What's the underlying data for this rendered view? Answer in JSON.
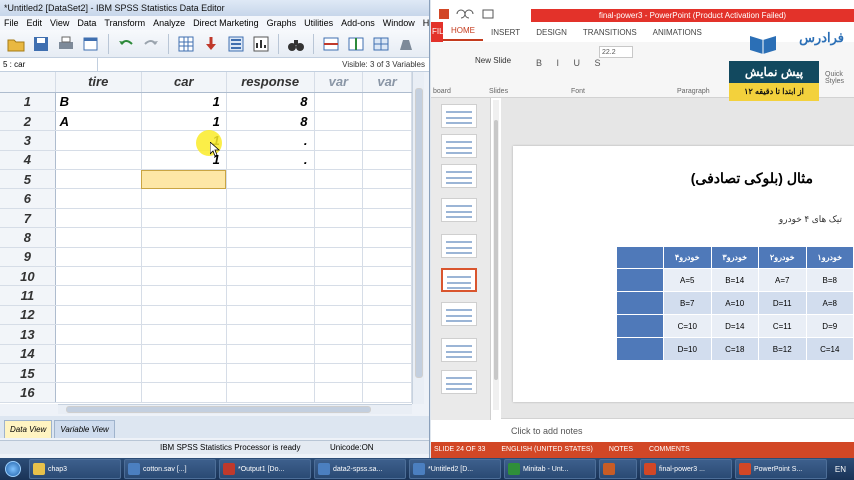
{
  "spss": {
    "title": "*Untitled2 [DataSet2] - IBM SPSS Statistics Data Editor",
    "menu": [
      "File",
      "Edit",
      "View",
      "Data",
      "Transform",
      "Analyze",
      "Direct Marketing",
      "Graphs",
      "Utilities",
      "Add-ons",
      "Window",
      "Help"
    ],
    "cell_ref": "5 : car",
    "cell_value": "",
    "visible_vars": "Visible: 3 of 3 Variables",
    "columns": [
      "tire",
      "car",
      "response",
      "var",
      "var"
    ],
    "rows": [
      {
        "n": "1",
        "tire": "B",
        "car": "1",
        "response": "8"
      },
      {
        "n": "2",
        "tire": "A",
        "car": "1",
        "response": "8"
      },
      {
        "n": "3",
        "tire": "",
        "car": "1",
        "response": "."
      },
      {
        "n": "4",
        "tire": "",
        "car": "1",
        "response": "."
      },
      {
        "n": "5",
        "tire": "",
        "car": "",
        "response": ""
      },
      {
        "n": "6",
        "tire": "",
        "car": "",
        "response": ""
      },
      {
        "n": "7",
        "tire": "",
        "car": "",
        "response": ""
      },
      {
        "n": "8",
        "tire": "",
        "car": "",
        "response": ""
      },
      {
        "n": "9",
        "tire": "",
        "car": "",
        "response": ""
      },
      {
        "n": "10",
        "tire": "",
        "car": "",
        "response": ""
      },
      {
        "n": "11",
        "tire": "",
        "car": "",
        "response": ""
      },
      {
        "n": "12",
        "tire": "",
        "car": "",
        "response": ""
      },
      {
        "n": "13",
        "tire": "",
        "car": "",
        "response": ""
      },
      {
        "n": "14",
        "tire": "",
        "car": "",
        "response": ""
      },
      {
        "n": "15",
        "tire": "",
        "car": "",
        "response": ""
      },
      {
        "n": "16",
        "tire": "",
        "car": "",
        "response": ""
      }
    ],
    "selected_row": 5,
    "tabs": {
      "data": "Data View",
      "variable": "Variable View"
    },
    "status": {
      "processor": "IBM SPSS Statistics Processor is ready",
      "unicode": "Unicode:ON"
    }
  },
  "ppt": {
    "title": "final-power3 - PowerPoint (Product Activation Failed)",
    "file_tab": "FILE",
    "tabs": [
      "HOME",
      "INSERT",
      "DESIGN",
      "TRANSITIONS",
      "ANIMATIONS"
    ],
    "active_tab": "HOME",
    "ribbon": {
      "new_slide": "New Slide",
      "font_size": "22.2",
      "groups": {
        "clipboard": "board",
        "slides": "Slides",
        "font": "Font",
        "paragraph": "Paragraph",
        "styles": "Styles"
      },
      "quick_styles": "Quick Styles"
    },
    "slide": {
      "title": "مثال (بلوکی تصادفی)",
      "subtitle": "تیک های ۴ خودرو",
      "table": [
        [
          "خودرو۱",
          "خودرو۲",
          "خودرو۳",
          "خودرو۴",
          ""
        ],
        [
          "B=8",
          "A=7",
          "B=14",
          "A=5",
          ""
        ],
        [
          "A=8",
          "D=11",
          "A=10",
          "B=7",
          ""
        ],
        [
          "D=9",
          "C=11",
          "D=14",
          "C=10",
          ""
        ],
        [
          "C=14",
          "B=12",
          "C=18",
          "D=10",
          ""
        ]
      ]
    },
    "notes": "Click to add notes",
    "status": {
      "slide": "SLIDE 24 OF 33",
      "lang": "ENGLISH (UNITED STATES)",
      "notes": "NOTES",
      "comments": "COMMENTS"
    }
  },
  "overlay": {
    "brand": "فرادرس",
    "banner_title": "پیش نمایش",
    "banner_sub": "از ابتدا تا دقیقه ۱۲"
  },
  "taskbar": {
    "items": [
      "chap3",
      "cotton.sav [...]",
      "*Output1 [Do...",
      "data2-spss.sa...",
      "*Untitled2 [D...",
      "Minitab - Unt...",
      "",
      "final-power3 ...",
      "PowerPoint S..."
    ],
    "icon_colors": [
      "#e8c14a",
      "#4b7fc0",
      "#c0392b",
      "#4b7fc0",
      "#4b7fc0",
      "#2f8f3a",
      "#c85c25",
      "#d24726",
      "#d24726"
    ],
    "lang": "EN"
  }
}
